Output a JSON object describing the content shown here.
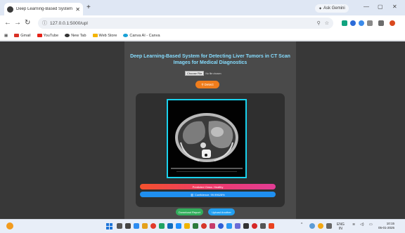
{
  "browser": {
    "tab_title": "Deep Learning-Based System f",
    "new_tab": "+",
    "close_glyph": "✕",
    "ask_gemini": "Ask Gemini",
    "url": "127.0.0.1:5000/upl",
    "bookmarks": [
      "Gmail",
      "YouTube",
      "New Tab",
      "Web Store",
      "Canva AI - Canva"
    ]
  },
  "page": {
    "title": "Deep Learning-Based System for Detecting Liver Tumors in CT Scan Images for Medical Diagnostics",
    "choose_file_label": "Choose File",
    "file_name": "No file chosen",
    "detect_label": "Detect",
    "prediction_label": "Predicted Class: Healthy",
    "confidence_label": "Confidence: 99.99628%",
    "download_label": "Download Report",
    "upload_label": "Upload Another"
  },
  "taskbar": {
    "lang_top": "ENG",
    "lang_bottom": "IN",
    "time": "10:15",
    "date": "05-01-2025"
  }
}
